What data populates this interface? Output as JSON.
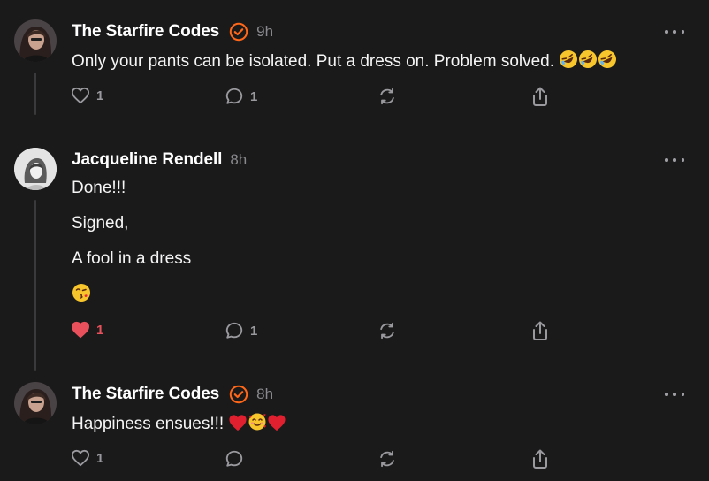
{
  "colors": {
    "background": "#1a1a1b",
    "accent_orange": "#ff6719",
    "like_red": "#e8505b",
    "muted_text": "#8a8a8e"
  },
  "comments": [
    {
      "author": "The Starfire Codes",
      "verified": true,
      "time": "9h",
      "body": [
        "Only your pants can be isolated. Put a dress on. Problem solved."
      ],
      "trailing_emoji": [
        "rolling-on-floor-laughing",
        "rolling-on-floor-laughing",
        "rolling-on-floor-laughing"
      ],
      "likes": "1",
      "liked": false,
      "replies": "1"
    },
    {
      "author": "Jacqueline Rendell",
      "verified": false,
      "time": "8h",
      "body": [
        "Done!!!",
        "Signed,",
        "A fool in a dress"
      ],
      "trailing_emoji": [
        "face-blowing-a-kiss"
      ],
      "likes": "1",
      "liked": true,
      "replies": "1"
    },
    {
      "author": "The Starfire Codes",
      "verified": true,
      "time": "8h",
      "body": [
        "Happiness ensues!!!"
      ],
      "trailing_emoji": [
        "red-heart",
        "smiling-face-with-hearts",
        "red-heart"
      ],
      "likes": "1",
      "liked": false,
      "replies": ""
    }
  ]
}
